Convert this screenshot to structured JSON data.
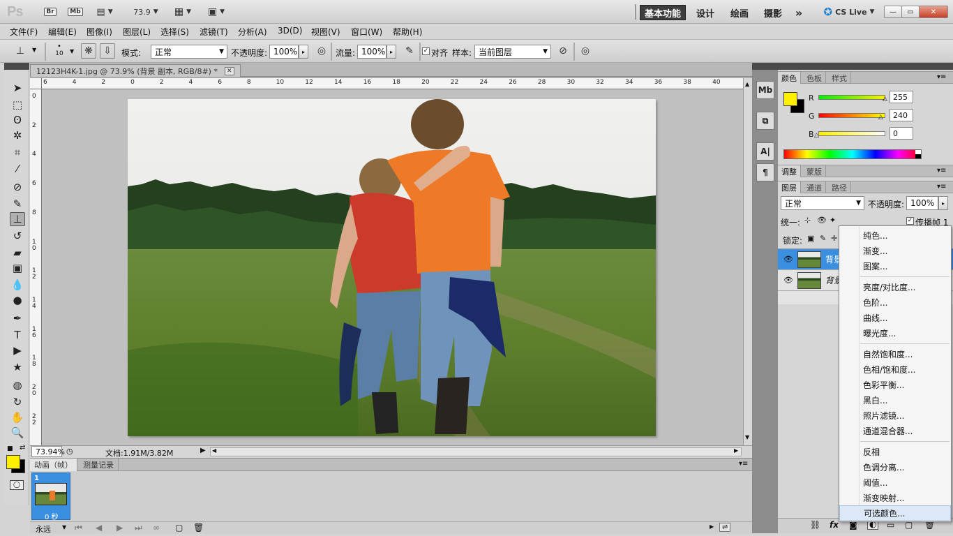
{
  "appbar": {
    "logo": "Ps",
    "br_label": "Br",
    "mb_label": "Mb",
    "zoom": "73.9",
    "workspaces": [
      "基本功能",
      "设计",
      "绘画",
      "摄影"
    ],
    "more": "»",
    "cslive": "CS Live",
    "win_buttons": [
      "—",
      "▭",
      "✕"
    ]
  },
  "menubar": {
    "items": [
      "文件(F)",
      "编辑(E)",
      "图像(I)",
      "图层(L)",
      "选择(S)",
      "滤镜(T)",
      "分析(A)",
      "3D(D)",
      "视图(V)",
      "窗口(W)",
      "帮助(H)"
    ]
  },
  "options": {
    "brush_size": "10",
    "mode_label": "模式:",
    "mode_value": "正常",
    "opacity_label": "不透明度:",
    "opacity_value": "100%",
    "flow_label": "流量:",
    "flow_value": "100%",
    "align_label": "对齐",
    "sample_label": "样本:",
    "sample_value": "当前图层"
  },
  "document": {
    "tab_title": "12123H4K-1.jpg @ 73.9% (背景 副本, RGB/8#) *",
    "ruler_top": [
      "6",
      "4",
      "2",
      "0",
      "2",
      "4",
      "6",
      "8",
      "10",
      "12",
      "14",
      "16",
      "18",
      "20",
      "22",
      "24",
      "26",
      "28",
      "30",
      "32",
      "34",
      "36",
      "38",
      "40"
    ],
    "ruler_left": [
      "0",
      "2",
      "4",
      "6",
      "8",
      "1\n0",
      "1\n2",
      "1\n4",
      "1\n6",
      "1\n8",
      "2\n0",
      "2\n2"
    ],
    "zoom_status": "73.94%",
    "doc_info": "文档:1.91M/3.82M"
  },
  "animation": {
    "tabs": [
      "动画（帧）",
      "测量记录"
    ],
    "frame_number": "1",
    "frame_delay": "0 秒",
    "loop": "永远"
  },
  "colorpanel": {
    "tabs": [
      "颜色",
      "色板",
      "样式"
    ],
    "channels": [
      {
        "label": "R",
        "value": "255",
        "level": 1.0
      },
      {
        "label": "G",
        "value": "240",
        "level": 0.94
      },
      {
        "label": "B",
        "value": "0",
        "level": 0.0
      }
    ],
    "foreground": "#fff000",
    "background": "#000000"
  },
  "adjustpanel": {
    "tabs": [
      "调整",
      "蒙版"
    ]
  },
  "layerspanel": {
    "tabs": [
      "图层",
      "通道",
      "路径"
    ],
    "blend_mode": "正常",
    "opacity_label": "不透明度:",
    "opacity_value": "100%",
    "unify_label": "统一:",
    "propagate_label": "传播帧 1",
    "lock_label": "锁定:",
    "layers": [
      {
        "name": "背景 副本",
        "selected": true
      },
      {
        "name": "背景",
        "selected": false
      }
    ]
  },
  "context_menu": {
    "groups": [
      [
        "纯色...",
        "渐变...",
        "图案..."
      ],
      [
        "亮度/对比度...",
        "色阶...",
        "曲线...",
        "曝光度..."
      ],
      [
        "自然饱和度...",
        "色相/饱和度...",
        "色彩平衡...",
        "黑白...",
        "照片滤镜...",
        "通道混合器..."
      ],
      [
        "反相",
        "色调分离...",
        "阈值...",
        "渐变映射...",
        "可选颜色..."
      ]
    ],
    "highlighted": "可选颜色..."
  }
}
